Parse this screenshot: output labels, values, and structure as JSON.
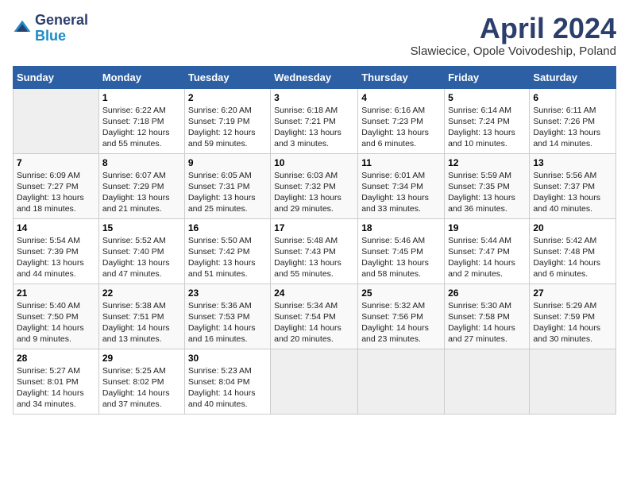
{
  "header": {
    "logo_general": "General",
    "logo_blue": "Blue",
    "month": "April 2024",
    "location": "Slawiecice, Opole Voivodeship, Poland"
  },
  "days_of_week": [
    "Sunday",
    "Monday",
    "Tuesday",
    "Wednesday",
    "Thursday",
    "Friday",
    "Saturday"
  ],
  "weeks": [
    [
      {
        "day": "",
        "info": ""
      },
      {
        "day": "1",
        "info": "Sunrise: 6:22 AM\nSunset: 7:18 PM\nDaylight: 12 hours\nand 55 minutes."
      },
      {
        "day": "2",
        "info": "Sunrise: 6:20 AM\nSunset: 7:19 PM\nDaylight: 12 hours\nand 59 minutes."
      },
      {
        "day": "3",
        "info": "Sunrise: 6:18 AM\nSunset: 7:21 PM\nDaylight: 13 hours\nand 3 minutes."
      },
      {
        "day": "4",
        "info": "Sunrise: 6:16 AM\nSunset: 7:23 PM\nDaylight: 13 hours\nand 6 minutes."
      },
      {
        "day": "5",
        "info": "Sunrise: 6:14 AM\nSunset: 7:24 PM\nDaylight: 13 hours\nand 10 minutes."
      },
      {
        "day": "6",
        "info": "Sunrise: 6:11 AM\nSunset: 7:26 PM\nDaylight: 13 hours\nand 14 minutes."
      }
    ],
    [
      {
        "day": "7",
        "info": "Sunrise: 6:09 AM\nSunset: 7:27 PM\nDaylight: 13 hours\nand 18 minutes."
      },
      {
        "day": "8",
        "info": "Sunrise: 6:07 AM\nSunset: 7:29 PM\nDaylight: 13 hours\nand 21 minutes."
      },
      {
        "day": "9",
        "info": "Sunrise: 6:05 AM\nSunset: 7:31 PM\nDaylight: 13 hours\nand 25 minutes."
      },
      {
        "day": "10",
        "info": "Sunrise: 6:03 AM\nSunset: 7:32 PM\nDaylight: 13 hours\nand 29 minutes."
      },
      {
        "day": "11",
        "info": "Sunrise: 6:01 AM\nSunset: 7:34 PM\nDaylight: 13 hours\nand 33 minutes."
      },
      {
        "day": "12",
        "info": "Sunrise: 5:59 AM\nSunset: 7:35 PM\nDaylight: 13 hours\nand 36 minutes."
      },
      {
        "day": "13",
        "info": "Sunrise: 5:56 AM\nSunset: 7:37 PM\nDaylight: 13 hours\nand 40 minutes."
      }
    ],
    [
      {
        "day": "14",
        "info": "Sunrise: 5:54 AM\nSunset: 7:39 PM\nDaylight: 13 hours\nand 44 minutes."
      },
      {
        "day": "15",
        "info": "Sunrise: 5:52 AM\nSunset: 7:40 PM\nDaylight: 13 hours\nand 47 minutes."
      },
      {
        "day": "16",
        "info": "Sunrise: 5:50 AM\nSunset: 7:42 PM\nDaylight: 13 hours\nand 51 minutes."
      },
      {
        "day": "17",
        "info": "Sunrise: 5:48 AM\nSunset: 7:43 PM\nDaylight: 13 hours\nand 55 minutes."
      },
      {
        "day": "18",
        "info": "Sunrise: 5:46 AM\nSunset: 7:45 PM\nDaylight: 13 hours\nand 58 minutes."
      },
      {
        "day": "19",
        "info": "Sunrise: 5:44 AM\nSunset: 7:47 PM\nDaylight: 14 hours\nand 2 minutes."
      },
      {
        "day": "20",
        "info": "Sunrise: 5:42 AM\nSunset: 7:48 PM\nDaylight: 14 hours\nand 6 minutes."
      }
    ],
    [
      {
        "day": "21",
        "info": "Sunrise: 5:40 AM\nSunset: 7:50 PM\nDaylight: 14 hours\nand 9 minutes."
      },
      {
        "day": "22",
        "info": "Sunrise: 5:38 AM\nSunset: 7:51 PM\nDaylight: 14 hours\nand 13 minutes."
      },
      {
        "day": "23",
        "info": "Sunrise: 5:36 AM\nSunset: 7:53 PM\nDaylight: 14 hours\nand 16 minutes."
      },
      {
        "day": "24",
        "info": "Sunrise: 5:34 AM\nSunset: 7:54 PM\nDaylight: 14 hours\nand 20 minutes."
      },
      {
        "day": "25",
        "info": "Sunrise: 5:32 AM\nSunset: 7:56 PM\nDaylight: 14 hours\nand 23 minutes."
      },
      {
        "day": "26",
        "info": "Sunrise: 5:30 AM\nSunset: 7:58 PM\nDaylight: 14 hours\nand 27 minutes."
      },
      {
        "day": "27",
        "info": "Sunrise: 5:29 AM\nSunset: 7:59 PM\nDaylight: 14 hours\nand 30 minutes."
      }
    ],
    [
      {
        "day": "28",
        "info": "Sunrise: 5:27 AM\nSunset: 8:01 PM\nDaylight: 14 hours\nand 34 minutes."
      },
      {
        "day": "29",
        "info": "Sunrise: 5:25 AM\nSunset: 8:02 PM\nDaylight: 14 hours\nand 37 minutes."
      },
      {
        "day": "30",
        "info": "Sunrise: 5:23 AM\nSunset: 8:04 PM\nDaylight: 14 hours\nand 40 minutes."
      },
      {
        "day": "",
        "info": ""
      },
      {
        "day": "",
        "info": ""
      },
      {
        "day": "",
        "info": ""
      },
      {
        "day": "",
        "info": ""
      }
    ]
  ]
}
